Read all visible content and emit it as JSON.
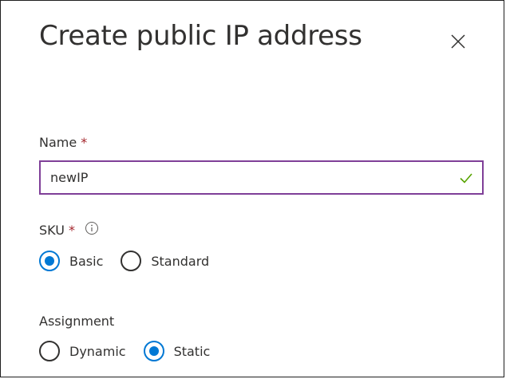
{
  "dialog": {
    "title": "Create public IP address",
    "close_icon": "close-icon"
  },
  "name_field": {
    "label": "Name",
    "required_mark": "*",
    "value": "newIP",
    "valid_icon": "checkmark-icon"
  },
  "sku": {
    "label": "SKU",
    "required_mark": "*",
    "info_icon": "info-icon",
    "options": [
      {
        "label": "Basic",
        "selected": true
      },
      {
        "label": "Standard",
        "selected": false
      }
    ]
  },
  "assignment": {
    "label": "Assignment",
    "options": [
      {
        "label": "Dynamic",
        "selected": false
      },
      {
        "label": "Static",
        "selected": true
      }
    ]
  },
  "colors": {
    "accent": "#0078d4",
    "input_border": "#7f3f98",
    "required": "#a4262c",
    "valid_check": "#57a300"
  }
}
